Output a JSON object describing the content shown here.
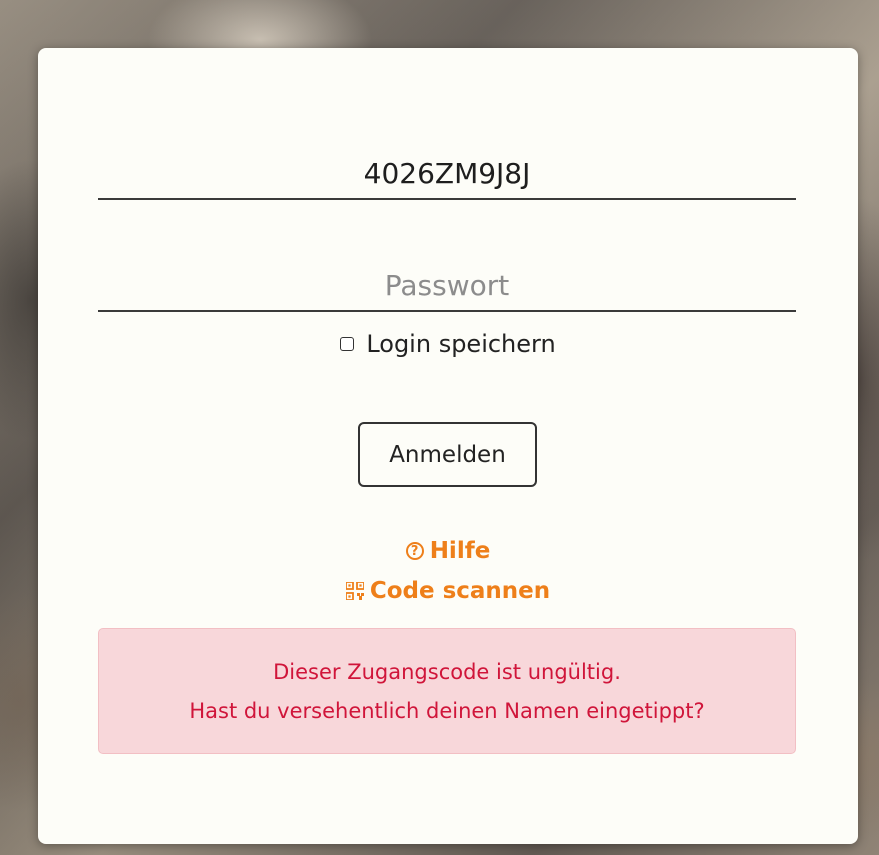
{
  "form": {
    "access_code_value": "4026ZM9J8J",
    "password_placeholder": "Passwort",
    "remember_label": "Login speichern",
    "login_button": "Anmelden"
  },
  "links": {
    "help": {
      "label": "Hilfe",
      "icon": "help-circle-icon"
    },
    "scan": {
      "label": "Code scannen",
      "icon": "qr-code-icon"
    }
  },
  "error": {
    "line1": "Dieser Zugangscode ist ungültig.",
    "line2": "Hast du versehentlich deinen Namen eingetippt?"
  },
  "colors": {
    "accent": "#ee7f1a",
    "error_text": "#d0153a",
    "error_background": "#f8d7da",
    "card_background": "#fdfdf8"
  }
}
